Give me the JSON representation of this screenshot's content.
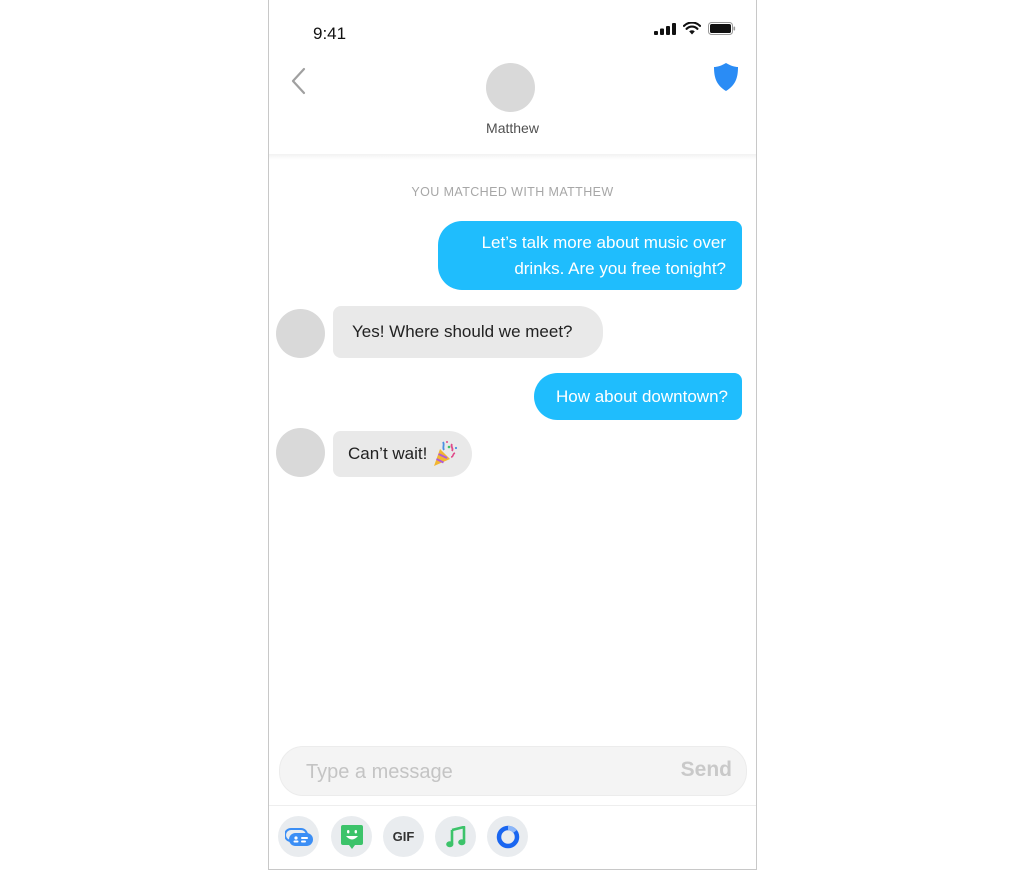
{
  "status_bar": {
    "time": "9:41",
    "icons": [
      "cellular-signal-icon",
      "wifi-icon",
      "battery-icon"
    ]
  },
  "header": {
    "back_icon": "chevron-left-icon",
    "contact_name": "Matthew",
    "safety_icon": "shield-icon",
    "accent_color": "#2a8cf5"
  },
  "conversation": {
    "match_label": "YOU MATCHED WITH MATTHEW",
    "messages": [
      {
        "direction": "outgoing",
        "lines": [
          "Let’s talk more about music over",
          "drinks. Are you free tonight?"
        ]
      },
      {
        "direction": "incoming",
        "text": "Yes! Where should we meet?"
      },
      {
        "direction": "outgoing",
        "text": "How about downtown?"
      },
      {
        "direction": "incoming",
        "text": "Can’t wait!",
        "emoji": "🎉"
      }
    ],
    "outgoing_color": "#1fbdfd",
    "incoming_color": "#e9e9e9"
  },
  "composer": {
    "placeholder": "Type a message",
    "value": "",
    "send_label": "Send"
  },
  "toolbar": {
    "items": [
      {
        "name": "contact-card-icon",
        "color": "#3b8ef5"
      },
      {
        "name": "sticker-icon",
        "color": "#3cc36a"
      },
      {
        "name": "gif-icon",
        "label": "GIF"
      },
      {
        "name": "music-note-icon",
        "color": "#3cc36a"
      },
      {
        "name": "loop-icon",
        "color": "#1a66f0"
      }
    ]
  }
}
